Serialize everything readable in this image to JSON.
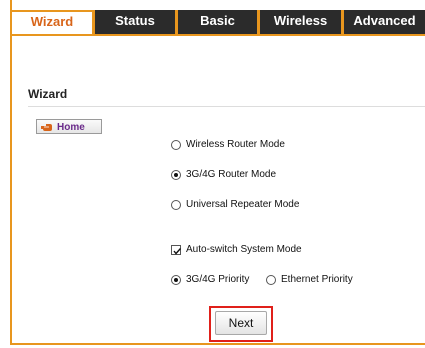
{
  "tabs": [
    {
      "label": "Wizard",
      "active": true
    },
    {
      "label": "Status",
      "active": false
    },
    {
      "label": "Basic",
      "active": false
    },
    {
      "label": "Wireless",
      "active": false
    },
    {
      "label": "Advanced",
      "active": false
    }
  ],
  "section": {
    "title": "Wizard"
  },
  "home_button": {
    "label": "Home"
  },
  "modes": [
    {
      "label": "Wireless Router Mode",
      "selected": false
    },
    {
      "label": "3G/4G Router Mode",
      "selected": true
    },
    {
      "label": "Universal Repeater Mode",
      "selected": false
    }
  ],
  "auto_switch": {
    "label": "Auto-switch System Mode",
    "checked": true
  },
  "priority": [
    {
      "label": "3G/4G Priority",
      "selected": true
    },
    {
      "label": "Ethernet Priority",
      "selected": false
    }
  ],
  "next_button": {
    "label": "Next"
  },
  "colors": {
    "accent": "#e8961e",
    "tab_active_text": "#d8651a",
    "highlight": "#e0201a",
    "tabbar": "#2b2b2b"
  }
}
